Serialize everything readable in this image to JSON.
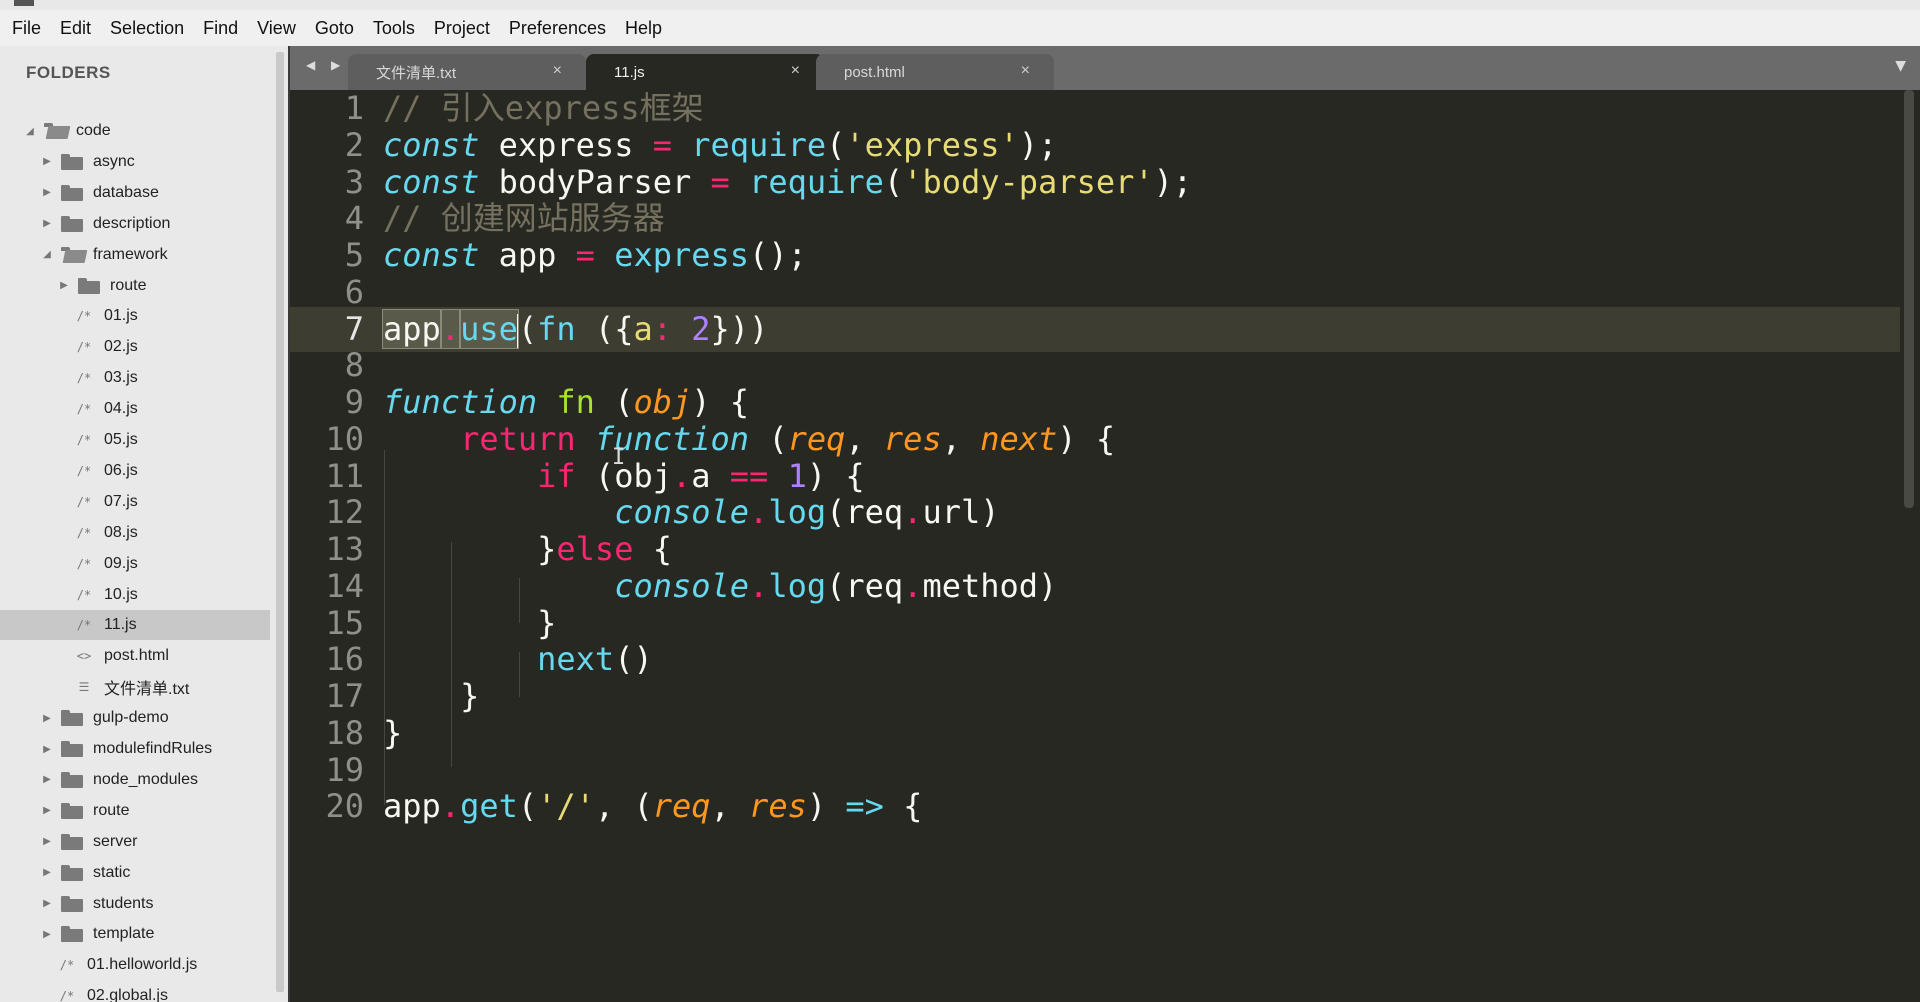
{
  "menubar": {
    "items": [
      "File",
      "Edit",
      "Selection",
      "Find",
      "View",
      "Goto",
      "Tools",
      "Project",
      "Preferences",
      "Help"
    ]
  },
  "sidebar": {
    "header": "FOLDERS",
    "tree": [
      {
        "label": "code",
        "kind": "folder-open",
        "depth": 0
      },
      {
        "label": "async",
        "kind": "folder",
        "depth": 1
      },
      {
        "label": "database",
        "kind": "folder",
        "depth": 1
      },
      {
        "label": "description",
        "kind": "folder",
        "depth": 1
      },
      {
        "label": "framework",
        "kind": "folder-open",
        "depth": 1
      },
      {
        "label": "route",
        "kind": "folder",
        "depth": 2
      },
      {
        "label": "01.js",
        "kind": "js",
        "depth": 2
      },
      {
        "label": "02.js",
        "kind": "js",
        "depth": 2
      },
      {
        "label": "03.js",
        "kind": "js",
        "depth": 2
      },
      {
        "label": "04.js",
        "kind": "js",
        "depth": 2
      },
      {
        "label": "05.js",
        "kind": "js",
        "depth": 2
      },
      {
        "label": "06.js",
        "kind": "js",
        "depth": 2
      },
      {
        "label": "07.js",
        "kind": "js",
        "depth": 2
      },
      {
        "label": "08.js",
        "kind": "js",
        "depth": 2
      },
      {
        "label": "09.js",
        "kind": "js",
        "depth": 2
      },
      {
        "label": "10.js",
        "kind": "js",
        "depth": 2
      },
      {
        "label": "11.js",
        "kind": "js",
        "depth": 2,
        "selected": true
      },
      {
        "label": "post.html",
        "kind": "html",
        "depth": 2
      },
      {
        "label": "文件清单.txt",
        "kind": "txt",
        "depth": 2
      },
      {
        "label": "gulp-demo",
        "kind": "folder",
        "depth": 1
      },
      {
        "label": "modulefindRules",
        "kind": "folder",
        "depth": 1
      },
      {
        "label": "node_modules",
        "kind": "folder",
        "depth": 1
      },
      {
        "label": "route",
        "kind": "folder",
        "depth": 1
      },
      {
        "label": "server",
        "kind": "folder",
        "depth": 1
      },
      {
        "label": "static",
        "kind": "folder",
        "depth": 1
      },
      {
        "label": "students",
        "kind": "folder",
        "depth": 1
      },
      {
        "label": "template",
        "kind": "folder",
        "depth": 1
      },
      {
        "label": "01.helloworld.js",
        "kind": "js",
        "depth": 1
      },
      {
        "label": "02.global.js",
        "kind": "js",
        "depth": 1
      }
    ]
  },
  "tabs": [
    {
      "label": "文件清单.txt",
      "active": false
    },
    {
      "label": "11.js",
      "active": true
    },
    {
      "label": "post.html",
      "active": false
    }
  ],
  "icons": {
    "tab_nav": "◀ ▶",
    "tab_close": "×",
    "dropdown": "▼",
    "arrow_open": "◢",
    "arrow_closed": "▶",
    "js_file": "/*",
    "html_file": "<>",
    "txt_file": "☰"
  },
  "editor": {
    "current_line": 7,
    "lines": [
      [
        [
          "c-comment",
          "// 引入express框架"
        ]
      ],
      [
        [
          "c-storage",
          "const"
        ],
        [
          "",
          " express "
        ],
        [
          "c-op",
          "="
        ],
        [
          "",
          " "
        ],
        [
          "c-func",
          "require"
        ],
        [
          "",
          "("
        ],
        [
          "c-string",
          "'express'"
        ],
        [
          "",
          ");"
        ]
      ],
      [
        [
          "c-storage",
          "const"
        ],
        [
          "",
          " bodyParser "
        ],
        [
          "c-op",
          "="
        ],
        [
          "",
          " "
        ],
        [
          "c-func",
          "require"
        ],
        [
          "",
          "("
        ],
        [
          "c-string",
          "'body-parser'"
        ],
        [
          "",
          ");"
        ]
      ],
      [
        [
          "c-comment",
          "// 创建网站服务器"
        ]
      ],
      [
        [
          "c-storage",
          "const"
        ],
        [
          "",
          " app "
        ],
        [
          "c-op",
          "="
        ],
        [
          "",
          " "
        ],
        [
          "c-func",
          "express"
        ],
        [
          "",
          "();"
        ]
      ],
      [],
      [
        [
          "selection",
          "app"
        ],
        [
          "selection c-op",
          "."
        ],
        [
          "selection c-func",
          "use"
        ],
        [
          "caret",
          ""
        ],
        [
          "",
          "("
        ],
        [
          "c-func",
          "fn"
        ],
        [
          "",
          " ({"
        ],
        [
          "c-string",
          "a"
        ],
        [
          "c-op",
          ":"
        ],
        [
          "",
          " "
        ],
        [
          "c-num",
          "2"
        ],
        [
          "",
          "}))"
        ]
      ],
      [],
      [
        [
          "c-storage",
          "function"
        ],
        [
          "",
          " "
        ],
        [
          "c-defname",
          "fn"
        ],
        [
          "",
          " ("
        ],
        [
          "c-param",
          "obj"
        ],
        [
          "",
          ") {"
        ]
      ],
      [
        [
          "",
          "    "
        ],
        [
          "c-keyword",
          "return"
        ],
        [
          "",
          " "
        ],
        [
          "c-storage",
          "function"
        ],
        [
          "",
          " ("
        ],
        [
          "c-param",
          "req"
        ],
        [
          "",
          ", "
        ],
        [
          "c-param",
          "res"
        ],
        [
          "",
          ", "
        ],
        [
          "c-param",
          "next"
        ],
        [
          "",
          ") {"
        ]
      ],
      [
        [
          "",
          "        "
        ],
        [
          "c-keyword",
          "if"
        ],
        [
          "",
          " (obj"
        ],
        [
          "c-op",
          "."
        ],
        [
          "",
          "a "
        ],
        [
          "c-op",
          "=="
        ],
        [
          "",
          " "
        ],
        [
          "c-num",
          "1"
        ],
        [
          "",
          ") {"
        ]
      ],
      [
        [
          "",
          "            "
        ],
        [
          "c-console",
          "console"
        ],
        [
          "c-op",
          "."
        ],
        [
          "c-func",
          "log"
        ],
        [
          "",
          "(req"
        ],
        [
          "c-op",
          "."
        ],
        [
          "",
          "url)"
        ]
      ],
      [
        [
          "",
          "        }"
        ],
        [
          "c-keyword",
          "else"
        ],
        [
          "",
          " {"
        ]
      ],
      [
        [
          "",
          "            "
        ],
        [
          "c-console",
          "console"
        ],
        [
          "c-op",
          "."
        ],
        [
          "c-func",
          "log"
        ],
        [
          "",
          "(req"
        ],
        [
          "c-op",
          "."
        ],
        [
          "",
          "method)"
        ]
      ],
      [
        [
          "",
          "        }"
        ]
      ],
      [
        [
          "",
          "        "
        ],
        [
          "c-func",
          "next"
        ],
        [
          "",
          "()"
        ]
      ],
      [
        [
          "",
          "    }"
        ]
      ],
      [
        [
          "",
          "}"
        ]
      ],
      [],
      [
        [
          "",
          "app"
        ],
        [
          "c-op",
          "."
        ],
        [
          "c-func",
          "get"
        ],
        [
          "",
          "("
        ],
        [
          "c-string",
          "'/'"
        ],
        [
          "",
          ", ("
        ],
        [
          "c-param",
          "req"
        ],
        [
          "",
          ", "
        ],
        [
          "c-param",
          "res"
        ],
        [
          "",
          ") "
        ],
        [
          "c-storage",
          "=>"
        ],
        [
          "",
          " {"
        ]
      ]
    ]
  }
}
